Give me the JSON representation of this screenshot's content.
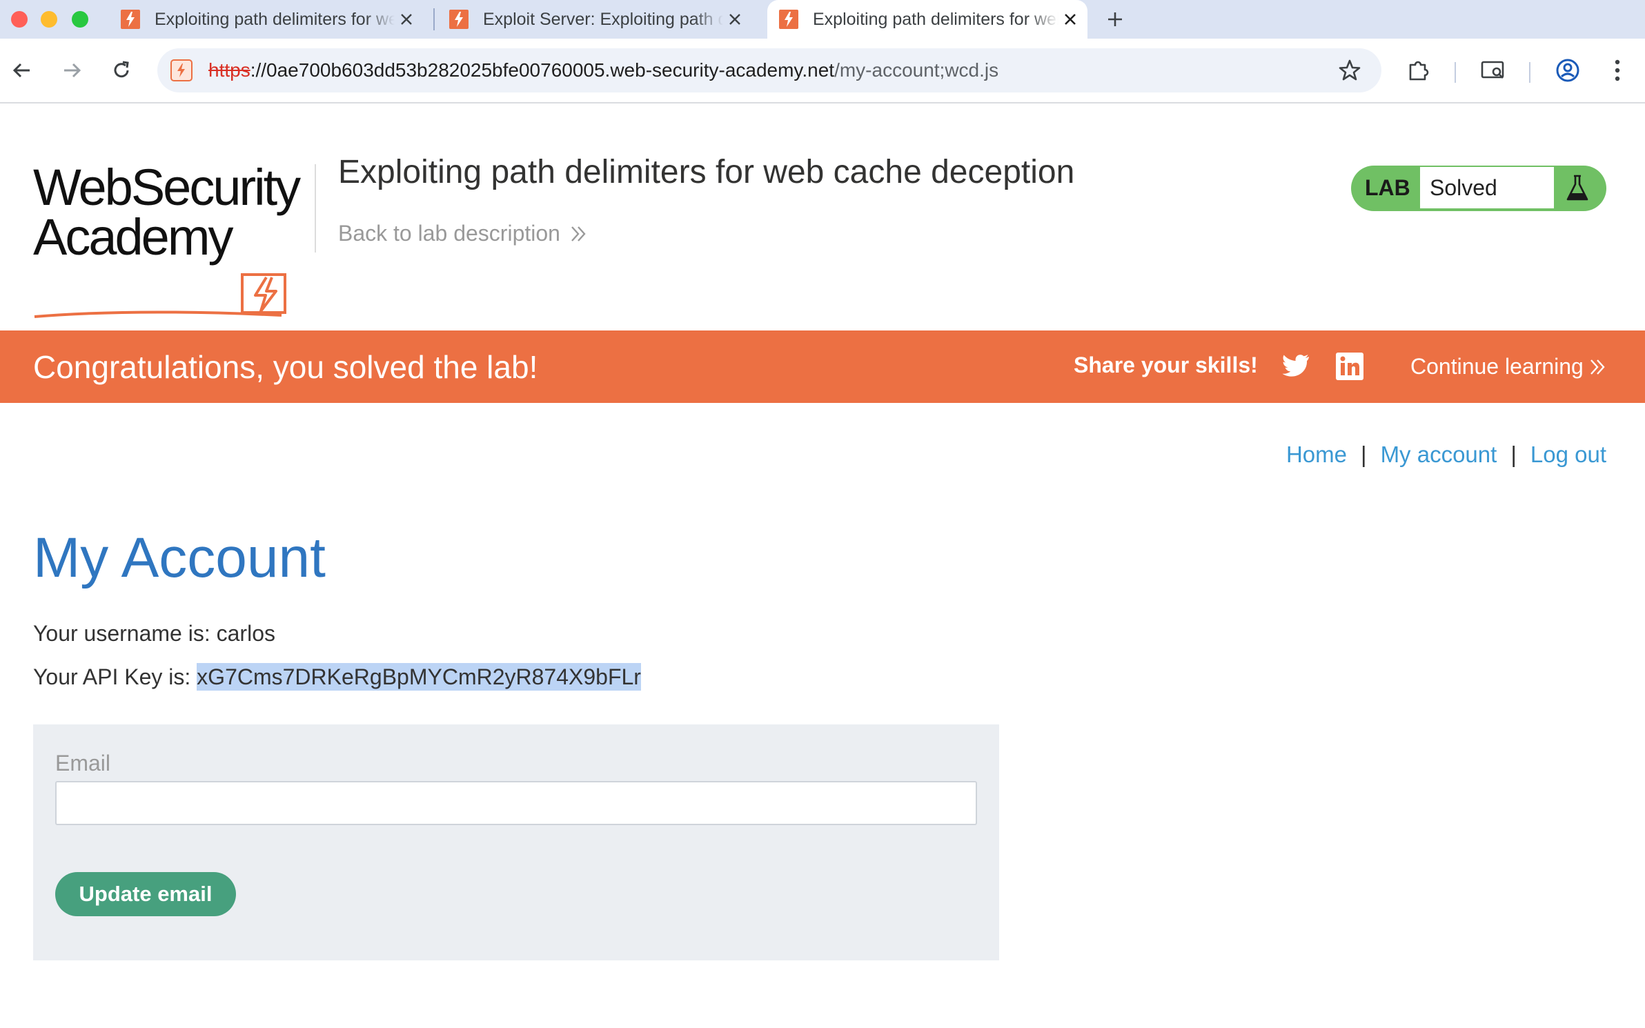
{
  "browser": {
    "tabs": [
      {
        "title": "Exploiting path delimiters for web cache deception",
        "active": false,
        "icon": "web-security-academy-favicon"
      },
      {
        "title": "Exploit Server: Exploiting path delimiters for web cache deception",
        "active": false,
        "icon": "web-security-academy-favicon"
      },
      {
        "title": "Exploiting path delimiters for web cache deception",
        "active": true,
        "icon": "web-security-academy-favicon"
      }
    ],
    "url": {
      "scheme": "https",
      "rest": "://0ae700b603dd53b282025bfe00760005.web-security-academy.net",
      "path": "/my-account;wcd.js"
    }
  },
  "header": {
    "logo_line1": "WebSecurity",
    "logo_line2": "Academy",
    "lab_title": "Exploiting path delimiters for web cache deception",
    "back_link": "Back to lab description",
    "badge_label": "LAB",
    "badge_status": "Solved"
  },
  "banner": {
    "message": "Congratulations, you solved the lab!",
    "share": "Share your skills!",
    "continue": "Continue learning"
  },
  "nav": {
    "home": "Home",
    "my_account": "My account",
    "log_out": "Log out",
    "separator": "|"
  },
  "account": {
    "heading": "My Account",
    "username_prefix": "Your username is: ",
    "username": "carlos",
    "api_prefix": "Your API Key is: ",
    "api_key": "xG7Cms7DRKeRgBpMYCmR2yR874X9bFLr",
    "email_label": "Email",
    "email_value": "",
    "update_button": "Update email"
  },
  "colors": {
    "brand_orange": "#ec7043",
    "lab_green": "#70c064",
    "heading_blue": "#2f76c0",
    "link_blue": "#3a98d3",
    "button_green": "#47a07e"
  }
}
